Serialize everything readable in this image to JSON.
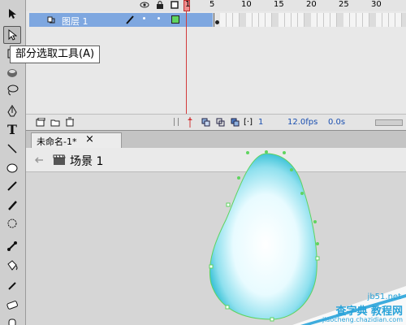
{
  "tooltip": {
    "text": "部分选取工具(A)"
  },
  "timeline": {
    "frame_numbers": [
      "1",
      "5",
      "10",
      "15",
      "20",
      "25",
      "30"
    ],
    "layer": {
      "name": "图层 1"
    },
    "current_frame": "1",
    "frame_rate": "12.0fps",
    "elapsed": "0.0s"
  },
  "document": {
    "tab_title": "未命名-1*",
    "close_symbol": "×",
    "scene_label": "场景 1"
  },
  "watermark": {
    "site": "jb51.net",
    "brand": "查字典 教程网",
    "url": "jiaocheng.chazidian.com"
  },
  "colors": {
    "layer_highlight": "#7ea7e0",
    "playhead": "#d23a3a",
    "shape_outline": "#5fd45f",
    "egg_fill_center": "#ffffff",
    "egg_fill_edge": "#3ec3d8",
    "watermark": "#29a3d9"
  },
  "icons": [
    "arrow-selection-icon",
    "subselection-icon",
    "free-transform-icon",
    "paint-bucket-icon",
    "lasso-icon",
    "pen-icon",
    "text-icon",
    "line-icon",
    "oval-icon",
    "pencil-icon",
    "brush-icon",
    "ink-bottle-icon",
    "bone-icon",
    "bucket-icon",
    "eyedropper-icon",
    "eraser-icon",
    "hand-icon"
  ]
}
